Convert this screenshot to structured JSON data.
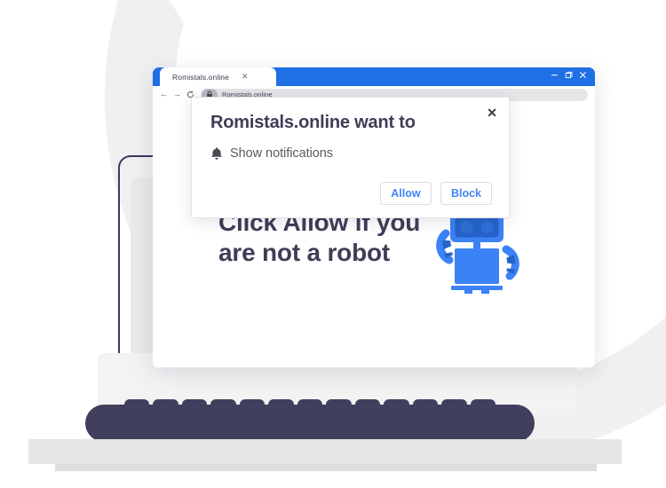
{
  "browser": {
    "tab": {
      "title": "Romistals.online",
      "close_label": "✕"
    },
    "window_controls": {
      "minimize": "minimize-icon",
      "maximize": "maximize-icon",
      "close": "close-icon"
    },
    "toolbar": {
      "back": "←",
      "forward": "→",
      "reload": "⟳",
      "lock": "lock-icon",
      "url": "Romistals.online"
    }
  },
  "page": {
    "headline": "Click Allow if you are not a robot",
    "robot_illustration": "robot-icon"
  },
  "dialog": {
    "title": "Romistals.online want to",
    "permission_icon": "bell-icon",
    "permission_label": "Show notifications",
    "close_label": "✕",
    "allow_label": "Allow",
    "block_label": "Block"
  },
  "colors": {
    "accent_blue": "#1f6fe5",
    "button_blue": "#4285f4",
    "robot_blue": "#3b82f6",
    "robot_dark": "#2563c9",
    "text_navy": "#3f3d56",
    "keyboard": "#413f5e",
    "screen_gray": "#e9e9ea",
    "desk_gray": "#e6e6e7"
  }
}
